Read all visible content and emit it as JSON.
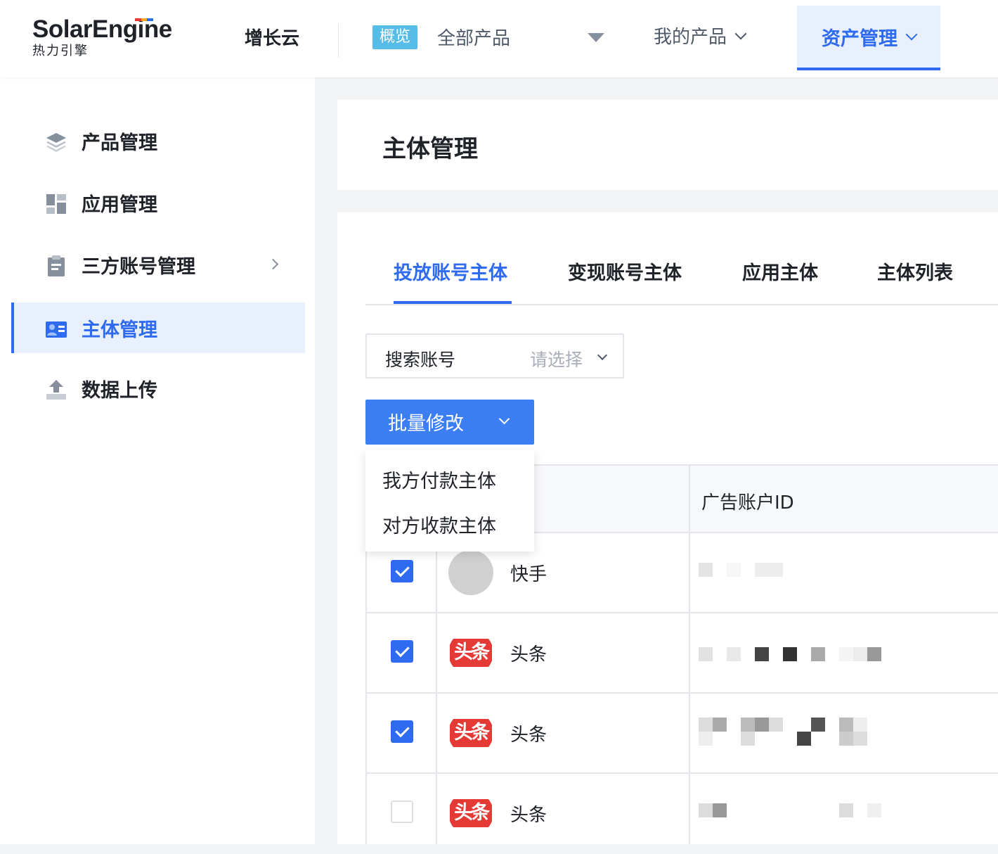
{
  "header": {
    "logo_text": "SolarEngine",
    "logo_subtext": "热力引擎",
    "cloud": "增长云",
    "badge": "概览",
    "product_selector": "全部产品",
    "my_products": "我的产品",
    "asset_management": "资产管理"
  },
  "sidebar": {
    "items": [
      {
        "label": "产品管理",
        "icon": "layers-icon"
      },
      {
        "label": "应用管理",
        "icon": "dashboard-icon"
      },
      {
        "label": "三方账号管理",
        "icon": "clipboard-icon"
      },
      {
        "label": "主体管理",
        "icon": "id-card-icon",
        "active": true
      },
      {
        "label": "数据上传",
        "icon": "upload-icon"
      }
    ]
  },
  "page": {
    "title": "主体管理",
    "tabs": [
      "投放账号主体",
      "变现账号主体",
      "应用主体",
      "主体列表"
    ],
    "active_tab": 0,
    "filter": {
      "label": "搜索账号",
      "placeholder": "请选择"
    },
    "batch_button": "批量修改",
    "dropdown": [
      "我方付款主体",
      "对方收款主体"
    ],
    "table": {
      "columns": [
        "",
        "",
        "广告账户ID"
      ],
      "rows": [
        {
          "checked": true,
          "platform": "快手",
          "avatar": "gray"
        },
        {
          "checked": true,
          "platform": "头条",
          "avatar": "toutiao"
        },
        {
          "checked": true,
          "platform": "头条",
          "avatar": "toutiao"
        },
        {
          "checked": false,
          "platform": "头条",
          "avatar": "toutiao"
        }
      ],
      "toutiao_logo_text": "头条"
    }
  },
  "colors": {
    "accent": "#2f6bf0",
    "button": "#3c7ff5",
    "badge": "#55bde8",
    "toutiao": "#e53935"
  }
}
